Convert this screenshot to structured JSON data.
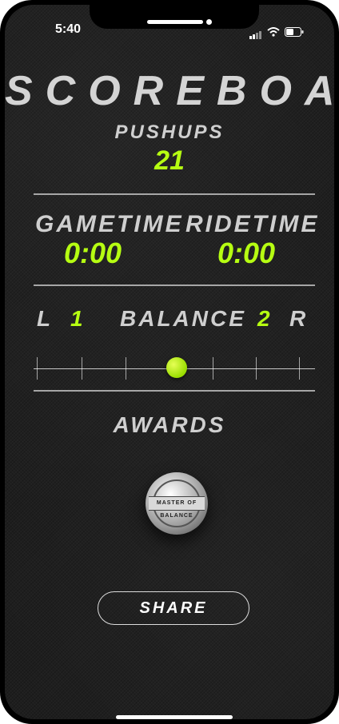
{
  "status_bar": {
    "time": "5:40"
  },
  "title": "SCOREBOARD",
  "pushups": {
    "label": "PUSHUPS",
    "value": "21"
  },
  "gametime": {
    "label": "GAMETIME",
    "value": "0:00"
  },
  "ridetime": {
    "label": "RIDETIME",
    "value": "0:00"
  },
  "balance": {
    "label": "BALANCE",
    "left_label": "L",
    "left_value": "1",
    "right_label": "R",
    "right_value": "2"
  },
  "awards": {
    "label": "AWARDS",
    "medal_text": "MASTER OF BALANCE"
  },
  "share": {
    "label": "SHARE"
  },
  "colors": {
    "accent": "#b6ff12",
    "text": "#cfcfcf",
    "background": "#1b1b1b"
  }
}
